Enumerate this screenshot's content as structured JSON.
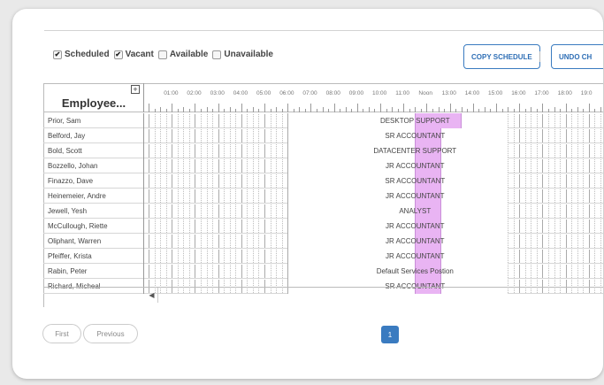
{
  "filters": [
    {
      "label": "Scheduled",
      "checked": true
    },
    {
      "label": "Vacant",
      "checked": true
    },
    {
      "label": "Available",
      "checked": false
    },
    {
      "label": "Unavailable",
      "checked": false
    }
  ],
  "toolbar": {
    "copy_label": "COPY SCHEDULE",
    "undo_label": "UNDO CH"
  },
  "grid": {
    "employee_header": "Employee...",
    "expand_symbol": "+",
    "hours": [
      "01:00",
      "02:00",
      "03:00",
      "04:00",
      "05:00",
      "06:00",
      "07:00",
      "08:00",
      "09:00",
      "10:00",
      "11:00",
      "Noon",
      "13:00",
      "14:00",
      "15:00",
      "16:00",
      "17:00",
      "18:00",
      "19:0"
    ],
    "rows": [
      {
        "name": "Prior, Sam",
        "shift": "DESKTOP SUPPORT",
        "extended_hours": 4.5
      },
      {
        "name": "Belford, Jay",
        "shift": "SR ACCOUNTANT",
        "extended_hours": 2.5
      },
      {
        "name": "Bold, Scott",
        "shift": "DATACENTER SUPPORT",
        "extended_hours": 2.5
      },
      {
        "name": "Bozzello, Johan",
        "shift": "JR ACCOUNTANT",
        "extended_hours": 2.5
      },
      {
        "name": "Finazzo, Dave",
        "shift": "SR ACCOUNTANT",
        "extended_hours": 2.5
      },
      {
        "name": "Heinemeier, Andre",
        "shift": "JR ACCOUNTANT",
        "extended_hours": 2.5
      },
      {
        "name": "Jewell, Yesh",
        "shift": "ANALYST",
        "extended_hours": 2.5
      },
      {
        "name": "McCullough, Riette",
        "shift": "JR ACCOUNTANT",
        "extended_hours": 2.5
      },
      {
        "name": "Oliphant, Warren",
        "shift": "JR ACCOUNTANT",
        "extended_hours": 2.5
      },
      {
        "name": "Pfeiffer, Krista",
        "shift": "JR ACCOUNTANT",
        "extended_hours": 2.5
      },
      {
        "name": "Rabin, Peter",
        "shift": "Default Services Postion",
        "extended_hours": 2.5
      },
      {
        "name": "Richard, Micheal",
        "shift": "SR ACCOUNTANT",
        "extended_hours": 2.5
      }
    ],
    "scroll_left_symbol": "◀"
  },
  "pagination": {
    "first_label": "First",
    "previous_label": "Previous",
    "current_page": "1"
  },
  "colors": {
    "accent": "#3a7bc0",
    "shift_highlight": "#e9b4f3"
  }
}
